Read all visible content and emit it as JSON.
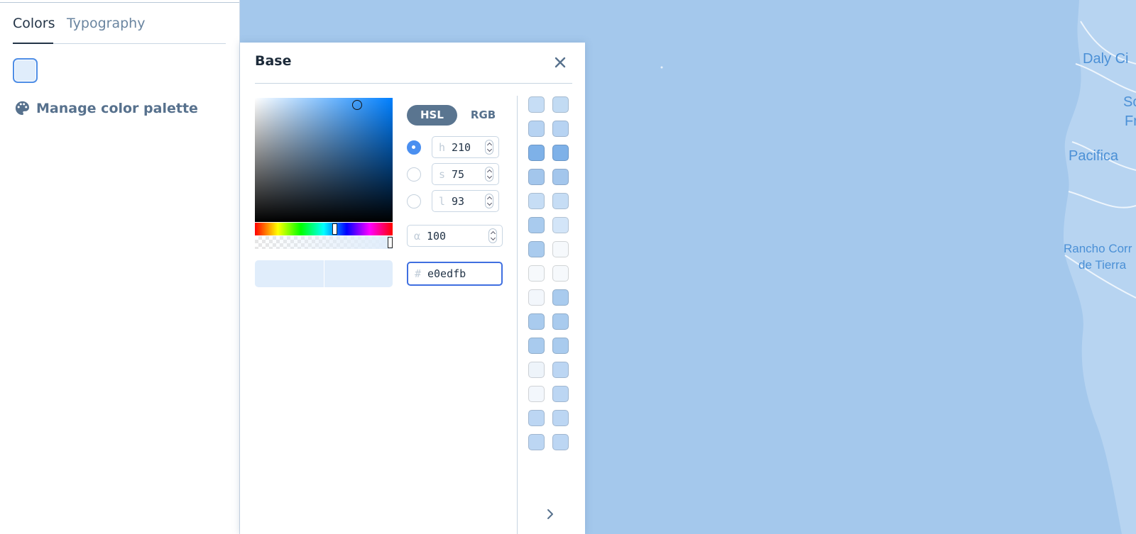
{
  "sidebar": {
    "tabs": [
      {
        "label": "Colors",
        "active": true
      },
      {
        "label": "Typography",
        "active": false
      }
    ],
    "current_color": "#e0edfb",
    "manage_palette_label": "Manage color palette"
  },
  "picker": {
    "title": "Base",
    "mode_tabs": [
      {
        "label": "HSL",
        "active": true
      },
      {
        "label": "RGB",
        "active": false
      }
    ],
    "channels": [
      {
        "prefix": "h",
        "value": "210",
        "selected": true
      },
      {
        "prefix": "s",
        "value": "75",
        "selected": false
      },
      {
        "prefix": "l",
        "value": "93",
        "selected": false
      }
    ],
    "alpha": {
      "prefix": "α",
      "value": "100"
    },
    "hex": {
      "prefix": "#",
      "value": "e0edfb"
    },
    "hue_fraction": 0.583,
    "alpha_fraction": 1.0,
    "palette_colors": [
      [
        "#c6ddf5",
        "#c2dbf3"
      ],
      [
        "#b7d3f2",
        "#b7d3f2"
      ],
      [
        "#7eb1e8",
        "#7eb1e8"
      ],
      [
        "#a3c6ec",
        "#a3c6ec"
      ],
      [
        "#c6ddf5",
        "#c6ddf5"
      ],
      [
        "#a9cbee",
        "#d3e5f8"
      ],
      [
        "#a9cbee",
        "#f6f9fc"
      ],
      [
        "#f6f9fc",
        "#f6f9fc"
      ],
      [
        "#f3f7fc",
        "#a9cbee"
      ],
      [
        "#a9cbee",
        "#a9cbee"
      ],
      [
        "#a9cbee",
        "#a9cbee"
      ],
      [
        "#eef4fa",
        "#bcd6f3"
      ],
      [
        "#f3f7fc",
        "#bcd6f3"
      ],
      [
        "#bcd6f3",
        "#bcd6f3"
      ],
      [
        "#bcd6f3",
        "#bcd6f3"
      ]
    ]
  },
  "map": {
    "water_color": "#a4c8ec",
    "labels": [
      "Daly Ci",
      "Sc",
      "Fr",
      "Pacifica",
      "Rancho Corr",
      "de Tierra"
    ]
  }
}
